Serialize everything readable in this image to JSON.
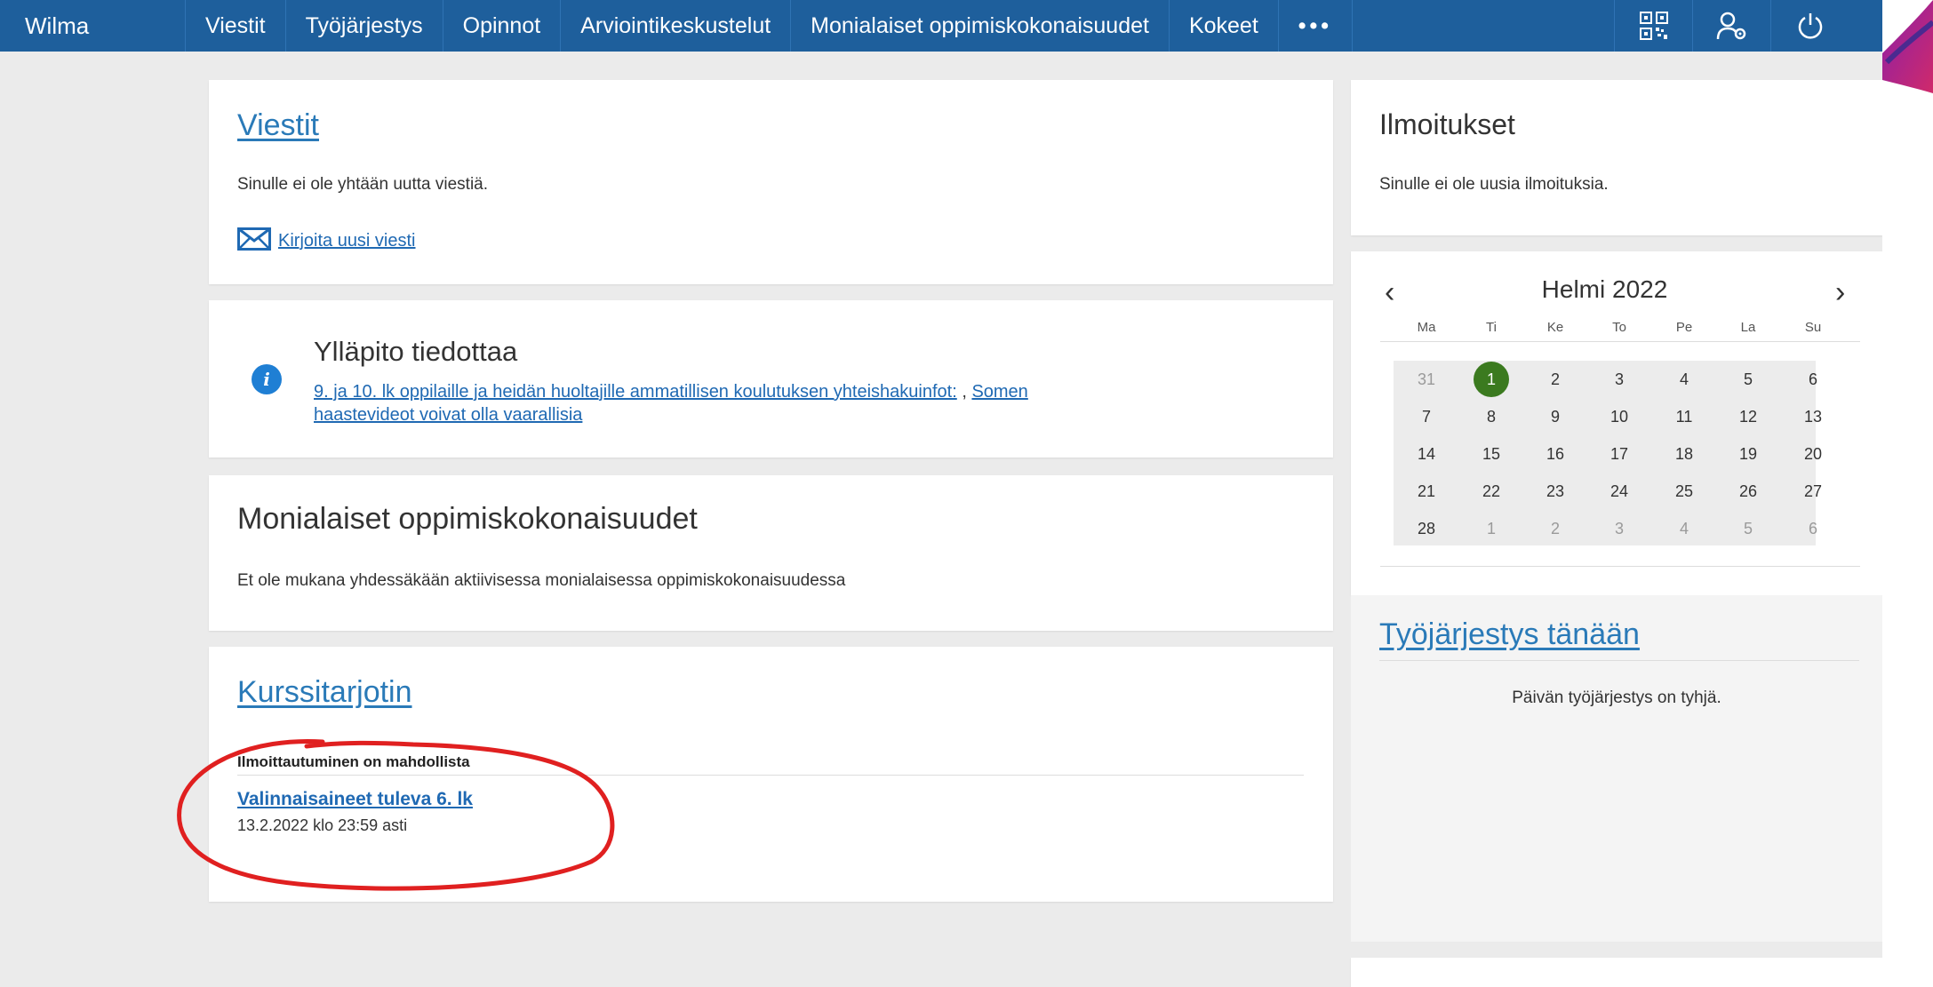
{
  "app": {
    "brand": "Wilma"
  },
  "nav": {
    "items": [
      "Viestit",
      "Työjärjestys",
      "Opinnot",
      "Arviointikeskustelut",
      "Monialaiset oppimiskokonaisuudet",
      "Kokeet"
    ],
    "more": "•••"
  },
  "top_icons": [
    "qr-code-icon",
    "user-settings-icon",
    "power-icon"
  ],
  "viestit": {
    "title": "Viestit",
    "message": "Sinulle ei ole yhtään uutta viestiä.",
    "new_message_link": "Kirjoita uusi viesti"
  },
  "yllapito": {
    "title": "Ylläpito tiedottaa",
    "link1": "9. ja 10. lk oppilaille ja heidän huoltajille ammatillisen koulutuksen yhteishakuinfot:",
    "separator": " , ",
    "link2_line1": "Somen",
    "link2_line2": "haastevideot voivat olla vaarallisia"
  },
  "monialaiset": {
    "title": "Monialaiset oppimiskokonaisuudet",
    "message": "Et ole mukana yhdessäkään aktiivisessa monialaisessa oppimiskokonaisuudessa"
  },
  "kurssitarjotin": {
    "title": "Kurssitarjotin",
    "subheading": "Ilmoittautuminen on mahdollista",
    "item_link": "Valinnaisaineet tuleva 6. lk",
    "item_deadline": "13.2.2022 klo 23:59 asti"
  },
  "ilmoitukset": {
    "title": "Ilmoitukset",
    "message": "Sinulle ei ole uusia ilmoituksia."
  },
  "calendar": {
    "month_label": "Helmi 2022",
    "prev": "‹",
    "next": "›",
    "weekdays": [
      "Ma",
      "Ti",
      "Ke",
      "To",
      "Pe",
      "La",
      "Su"
    ],
    "weeks": [
      [
        "31",
        "1",
        "2",
        "3",
        "4",
        "5",
        "6"
      ],
      [
        "7",
        "8",
        "9",
        "10",
        "11",
        "12",
        "13"
      ],
      [
        "14",
        "15",
        "16",
        "17",
        "18",
        "19",
        "20"
      ],
      [
        "21",
        "22",
        "23",
        "24",
        "25",
        "26",
        "27"
      ],
      [
        "28",
        "1",
        "2",
        "3",
        "4",
        "5",
        "6"
      ]
    ],
    "today": "1",
    "today_color": "#3b7a1f"
  },
  "tyojarjestys": {
    "title": "Työjärjestys tänään",
    "message": "Päivän työjärjestys on tyhjä."
  },
  "colors": {
    "nav_bg": "#1e5f9c",
    "link": "#2a7ab8",
    "annotation": "#e02020"
  }
}
